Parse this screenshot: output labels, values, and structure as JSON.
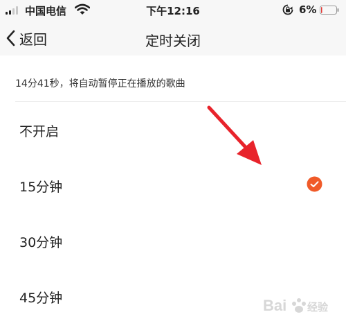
{
  "status_bar": {
    "carrier": "中国电信",
    "time": "下午12:16",
    "battery_percent": "6%",
    "battery_level": 0.06,
    "battery_color": "#e53935"
  },
  "nav": {
    "back_label": "返回",
    "title": "定时关闭"
  },
  "hint": {
    "text": "14分41秒，将自动暂停正在播放的歌曲"
  },
  "options": [
    {
      "label": "不开启",
      "selected": false
    },
    {
      "label": "15分钟",
      "selected": true
    },
    {
      "label": "30分钟",
      "selected": false
    },
    {
      "label": "45分钟",
      "selected": false
    }
  ],
  "colors": {
    "accent": "#f05a28",
    "annotation_arrow": "#e8232b"
  },
  "watermark": {
    "text": "Baidu经验"
  }
}
